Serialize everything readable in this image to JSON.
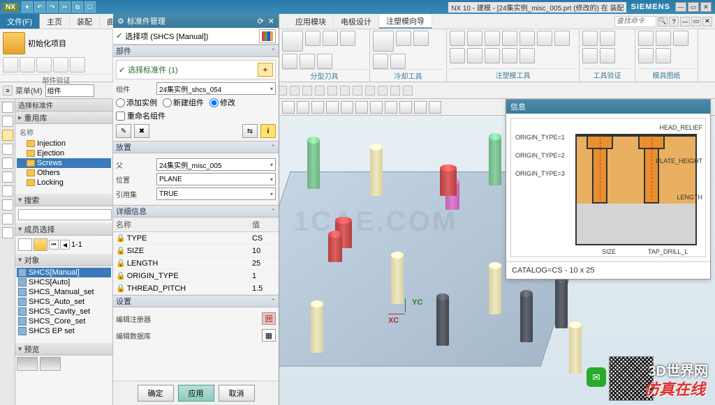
{
  "titlebar": {
    "app": "NX",
    "title": "NX 10 - 建模 - [24集实例_misc_005.prt (修改的) 在 装配",
    "siemens": "SIEMENS"
  },
  "menubar": {
    "file": "文件(F)",
    "tabs": [
      "主页",
      "装配",
      "曲",
      "应用模块",
      "电极设计",
      "注塑模向导"
    ],
    "active_tab": 5,
    "search_placeholder": "查找命令"
  },
  "ribbon_left": {
    "big_label": "初始化项目",
    "group_label": "部件验证"
  },
  "ribbon_groups": [
    "分型刀具",
    "冷却工具",
    "注塑模工具",
    "工具验证",
    "模具图纸"
  ],
  "toolbar2": {
    "menu_label": "菜单(M)",
    "combo1": "组件"
  },
  "left_panels": {
    "select_part": "选择标准件",
    "reuse_lib": "重用库",
    "name_col": "名称",
    "tree": [
      "Injection",
      "Ejection",
      "Screws",
      "Others",
      "Locking"
    ],
    "tree_selected": 2,
    "search": "搜索",
    "member": "成员选择",
    "page": "1-1",
    "objects": "对象",
    "obj_list": [
      "SHCS[Manual]",
      "SHCS[Auto]",
      "SHCS_Manual_set",
      "SHCS_Auto_set",
      "SHCS_Cavity_set",
      "SHCS_Core_set",
      "SHCS EP set"
    ],
    "obj_selected": 0,
    "preview": "预览"
  },
  "dialog": {
    "title": "标准件管理",
    "select_item": "选择项 (SHCS [Manual])",
    "part_section": "部件",
    "select_std": "选择标准件 (1)",
    "component_label": "组件",
    "component_value": "24集实例_shcs_054",
    "radios": {
      "add": "添加实例",
      "new": "新建组件",
      "modify": "修改"
    },
    "radio_selected": "modify",
    "rename": "重命名组件",
    "placement_section": "放置",
    "parent_label": "父",
    "parent_value": "24集实例_misc_005",
    "position_label": "位置",
    "position_value": "PLANE",
    "refset_label": "引用集",
    "refset_value": "TRUE",
    "detail_section": "详细信息",
    "detail_cols": {
      "name": "名称",
      "value": "值"
    },
    "details": [
      {
        "name": "TYPE",
        "value": "CS"
      },
      {
        "name": "SIZE",
        "value": "10"
      },
      {
        "name": "LENGTH",
        "value": "25"
      },
      {
        "name": "ORIGIN_TYPE",
        "value": "1"
      },
      {
        "name": "THREAD_PITCH",
        "value": "1.5"
      }
    ],
    "settings_section": "设置",
    "edit_reg": "编辑注册器",
    "edit_db": "编辑数据库",
    "buttons": {
      "ok": "确定",
      "apply": "应用",
      "cancel": "取消"
    }
  },
  "info_panel": {
    "title": "信息",
    "labels": {
      "origin1": "ORIGIN_TYPE=1",
      "origin2": "ORIGIN_TYPE=2",
      "origin3": "ORIGIN_TYPE=3",
      "head_relief": "HEAD_RELIEF",
      "plate_height": "PLATE_HEIGHT",
      "length": "LENGTH",
      "size": "SIZE",
      "tap_drill": "TAP_DRILL_L"
    },
    "catalog": "CATALOG=CS - 10 x 25"
  },
  "triad": {
    "x": "XC",
    "y": "YC"
  },
  "overlay": {
    "watermark_center": "1CAE.COM",
    "brand": "3D世界网",
    "sim": "仿真在线"
  }
}
